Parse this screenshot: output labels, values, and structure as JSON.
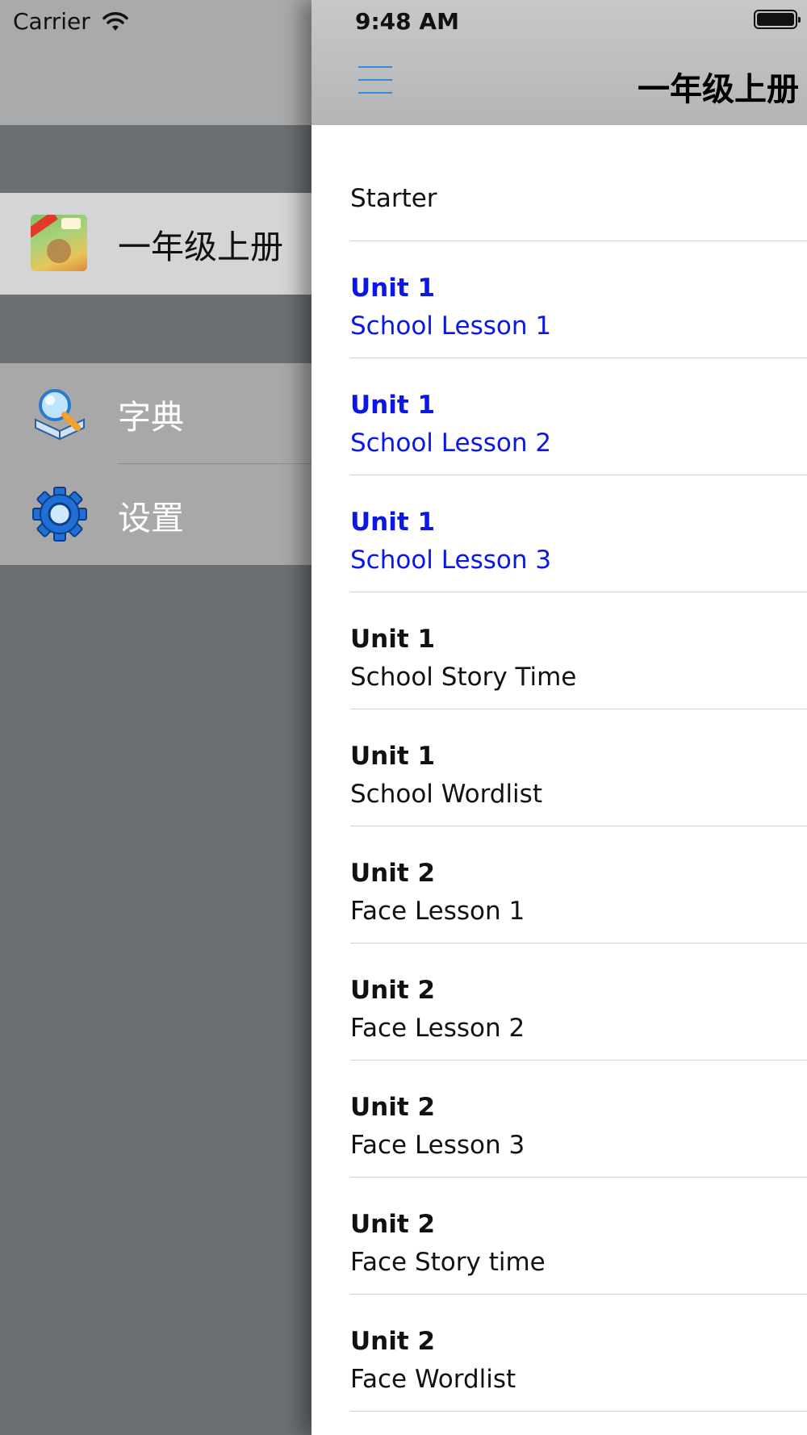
{
  "status": {
    "carrier": "Carrier",
    "time": "9:48 AM"
  },
  "drawer": {
    "current_book": "一年级上册",
    "items": [
      {
        "label": "字典",
        "icon": "dictionary-icon"
      },
      {
        "label": "设置",
        "icon": "gear-icon"
      }
    ]
  },
  "navbar": {
    "title": "一年级上册",
    "menu_icon": "hamburger-icon"
  },
  "colors": {
    "accent_blue": "#0b17e6",
    "menu_blue": "#2f8ede"
  },
  "list": [
    {
      "text": "Starter"
    },
    {
      "unit": "Unit 1",
      "lesson": "School Lesson 1",
      "highlighted": true
    },
    {
      "unit": "Unit 1",
      "lesson": "School Lesson 2",
      "highlighted": true
    },
    {
      "unit": "Unit 1",
      "lesson": "School Lesson 3",
      "highlighted": true
    },
    {
      "unit": "Unit 1",
      "lesson": "School Story Time"
    },
    {
      "unit": "Unit 1",
      "lesson": "School Wordlist"
    },
    {
      "unit": "Unit 2",
      "lesson": "Face Lesson 1"
    },
    {
      "unit": "Unit 2",
      "lesson": "Face Lesson 2"
    },
    {
      "unit": "Unit 2",
      "lesson": "Face Lesson 3"
    },
    {
      "unit": "Unit 2",
      "lesson": "Face Story time"
    },
    {
      "unit": "Unit 2",
      "lesson": "Face Wordlist"
    }
  ]
}
